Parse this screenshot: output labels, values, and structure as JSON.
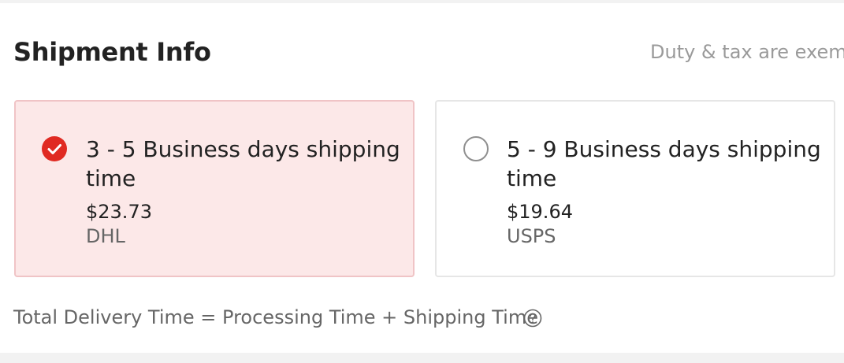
{
  "section": {
    "title": "Shipment Info",
    "note": "Duty & tax are exemp"
  },
  "options": [
    {
      "title": "3 - 5 Business days shipping time",
      "price": "$23.73",
      "carrier": "DHL",
      "selected": true
    },
    {
      "title": "5 - 9 Business days shipping time",
      "price": "$19.64",
      "carrier": "USPS",
      "selected": false
    }
  ],
  "footer": {
    "text": "Total Delivery Time = Processing Time + Shipping Time",
    "icon": "help-circle-icon"
  },
  "colors": {
    "accent": "#e02a22",
    "selected_bg": "#fce8e8",
    "selected_border": "#f0c4c6"
  }
}
